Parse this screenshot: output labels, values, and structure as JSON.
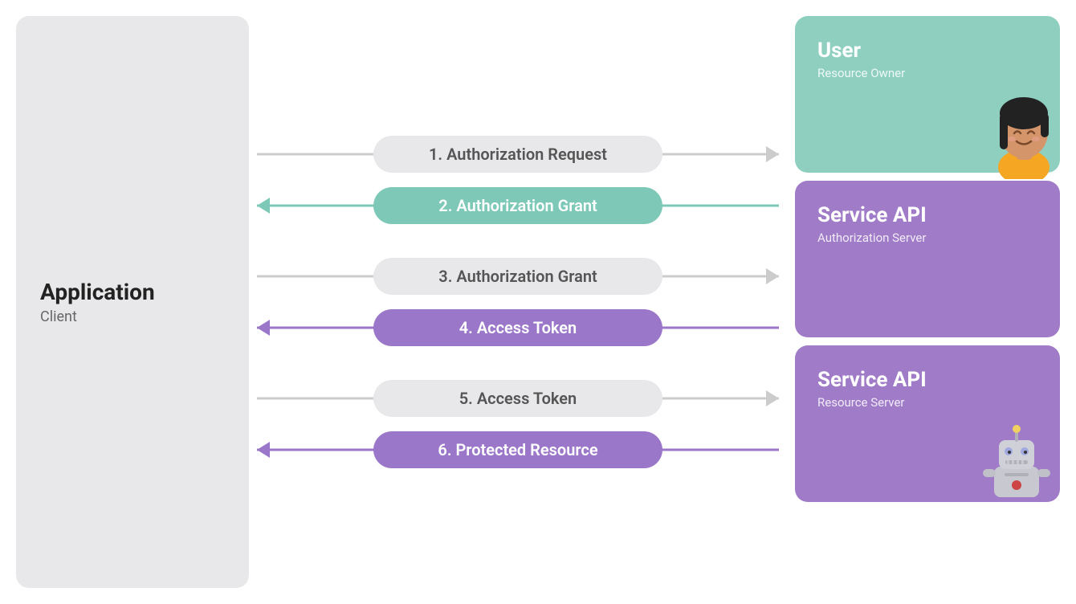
{
  "client": {
    "title": "Application",
    "subtitle": "Client"
  },
  "arrows": {
    "group1": {
      "arrow1": {
        "label": "1. Authorization Request",
        "direction": "right",
        "style": "gray"
      },
      "arrow2": {
        "label": "2. Authorization Grant",
        "direction": "left",
        "style": "green"
      }
    },
    "group2": {
      "arrow1": {
        "label": "3. Authorization Grant",
        "direction": "right",
        "style": "gray"
      },
      "arrow2": {
        "label": "4. Access Token",
        "direction": "left",
        "style": "purple"
      }
    },
    "group3": {
      "arrow1": {
        "label": "5. Access Token",
        "direction": "right",
        "style": "gray"
      },
      "arrow2": {
        "label": "6. Protected Resource",
        "direction": "left",
        "style": "purple"
      }
    }
  },
  "boxes": {
    "user": {
      "title": "User",
      "subtitle": "Resource Owner"
    },
    "service_api_auth": {
      "title": "Service API",
      "subtitle": "Authorization Server"
    },
    "service_api_resource": {
      "title": "Service API",
      "subtitle": "Resource Server"
    }
  }
}
